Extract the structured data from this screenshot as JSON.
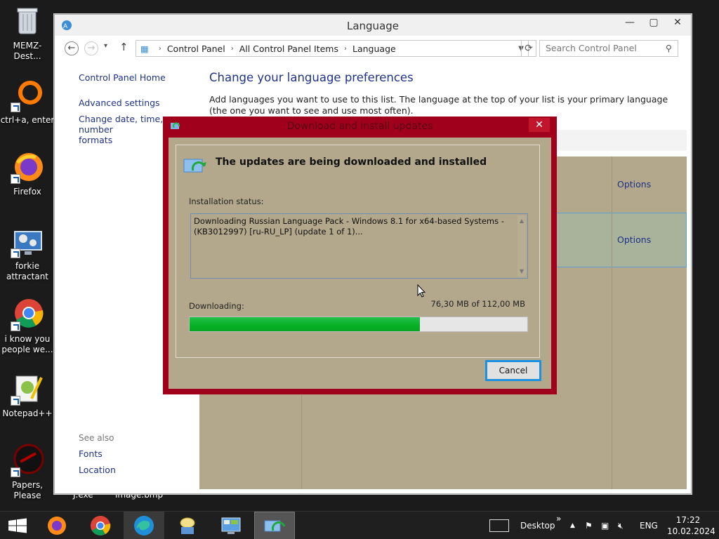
{
  "desktop": {
    "icons": [
      {
        "label": "MEMZ-Dest..."
      },
      {
        "label": "ctrl+a, enter"
      },
      {
        "label": "Firefox"
      },
      {
        "label": "forkie attractant"
      },
      {
        "label": "i know you people we..."
      },
      {
        "label": "Notepad++"
      },
      {
        "label": "Papers, Please"
      }
    ],
    "hidden_labels": [
      "J.exe",
      "image.bmp"
    ]
  },
  "window": {
    "title": "Language",
    "breadcrumb": [
      "Control Panel",
      "All Control Panel Items",
      "Language"
    ],
    "search_placeholder": "Search Control Panel",
    "left_nav": {
      "home": "Control Panel Home",
      "advanced": "Advanced settings",
      "change_date": "Change date, time, or number",
      "formats": "formats",
      "see_also": "See also",
      "fonts": "Fonts",
      "location": "Location"
    },
    "heading": "Change your language preferences",
    "intro": "Add languages you want to use to this list. The language at the top of your list is your primary language (the one you want to see and use most often).",
    "options_label": "Options"
  },
  "dialog": {
    "title": "Download and install updates",
    "heading": "The updates are being downloaded and installed",
    "status_label": "Installation status:",
    "status_text": "Downloading Russian Language Pack - Windows 8.1 for x64-based Systems - (KB3012997) [ru-RU_LP] (update 1 of 1)...",
    "downloading_label": "Downloading:",
    "size_text": "76,30 MB of 112,00 MB",
    "progress": 0.6813,
    "cancel_label": "Cancel"
  },
  "taskbar": {
    "desktop_label": "Desktop",
    "lang": "ENG",
    "time": "17:22",
    "date": "10.02.2024"
  }
}
